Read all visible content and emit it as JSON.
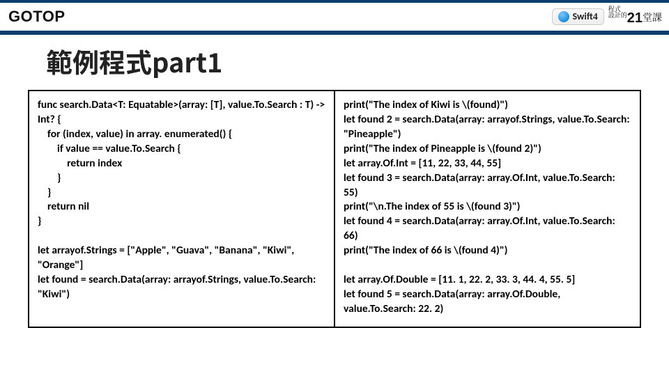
{
  "header": {
    "logo": "GOTOP",
    "swift_label": "Swift",
    "swift_version": "4",
    "course_small_top": "程式",
    "course_small_bottom": "設計的",
    "course_big": "21",
    "course_tail": "堂課"
  },
  "title": "範例程式part1",
  "code": {
    "left": "func search.Data<T: Equatable>(array: [T], value.To.Search : T) -> Int? {\n    for (index, value) in array. enumerated() {\n        if value == value.To.Search {\n            return index\n        }\n    }\n    return nil\n}\n\nlet arrayof.Strings = [\"Apple\", \"Guava\", \"Banana\", \"Kiwi\", \"Orange\"]\nlet found = search.Data(array: arrayof.Strings, value.To.Search: \"Kiwi\")",
    "right": "print(\"The index of Kiwi is \\(found)\")\nlet found 2 = search.Data(array: arrayof.Strings, value.To.Search: \"Pineapple\")\nprint(\"The index of Pineapple is \\(found 2)\")\nlet array.Of.Int = [11, 22, 33, 44, 55]\nlet found 3 = search.Data(array: array.Of.Int, value.To.Search: 55)\nprint(\"\\n.The index of 55 is \\(found 3)\")\nlet found 4 = search.Data(array: array.Of.Int, value.To.Search: 66)\nprint(\"The index of 66 is \\(found 4)\")\n\nlet array.Of.Double = [11. 1, 22. 2, 33. 3, 44. 4, 55. 5]\nlet found 5 = search.Data(array: array.Of.Double, value.To.Search: 22. 2)"
  }
}
